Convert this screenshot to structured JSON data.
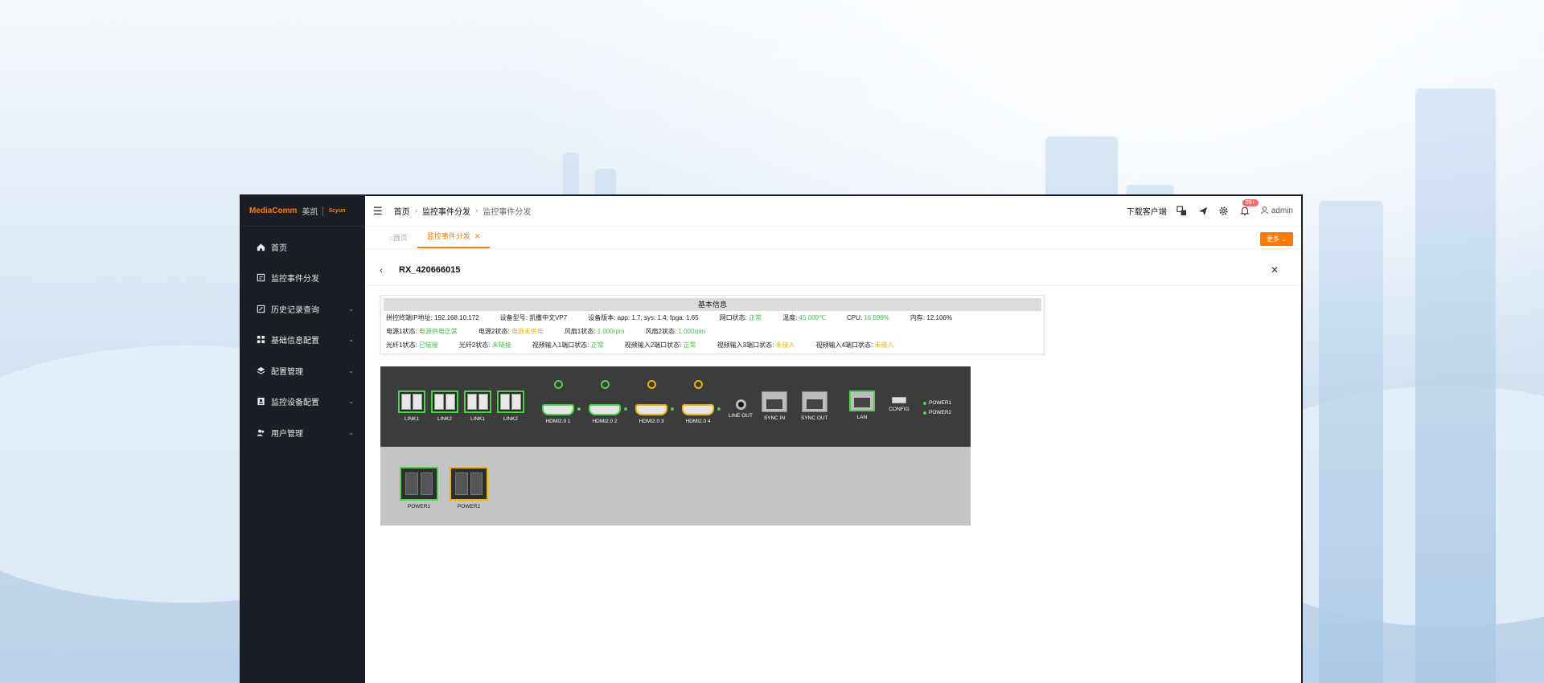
{
  "sidebar": {
    "logo_main": "MediaComm",
    "logo_cn": "美凯",
    "logo_sub": "Scyun",
    "items": [
      {
        "label": "首页",
        "icon": "home-icon"
      },
      {
        "label": "监控事件分发",
        "icon": "monitor-event-icon"
      },
      {
        "label": "历史记录查询",
        "icon": "history-icon"
      },
      {
        "label": "基础信息配置",
        "icon": "grid-config-icon"
      },
      {
        "label": "配置管理",
        "icon": "layers-icon"
      },
      {
        "label": "监控设备配置",
        "icon": "device-icon"
      },
      {
        "label": "用户管理",
        "icon": "users-icon"
      }
    ]
  },
  "topbar": {
    "breadcrumb": [
      "首页",
      "监控事件分发",
      "监控事件分发"
    ],
    "download": "下载客户端",
    "badge": "99+",
    "user": "admin"
  },
  "tabs": {
    "items": [
      {
        "label": "首页"
      },
      {
        "label": "监控事件分发",
        "active": true
      }
    ],
    "more": "更多"
  },
  "detail": {
    "title": "RX_420666015"
  },
  "info": {
    "title": "基本信息",
    "row1": [
      {
        "k": "拼控终端IP地址: ",
        "v": "192.168.10.172",
        "c": ""
      },
      {
        "k": "设备型号: ",
        "v": "凯撒中文VP7",
        "c": ""
      },
      {
        "k": "设备版本: ",
        "v": "app: 1.7; sys: 1.4; fpga: 1.65",
        "c": ""
      },
      {
        "k": "网口状态: ",
        "v": "正常",
        "c": "green"
      },
      {
        "k": "温度: ",
        "v": "45.000℃",
        "c": "green"
      },
      {
        "k": "CPU: ",
        "v": "16.598%",
        "c": "green"
      },
      {
        "k": "内存: ",
        "v": "12.106%",
        "c": ""
      }
    ],
    "row2": [
      {
        "k": "电源1状态: ",
        "v": "电源供电正常",
        "c": "green"
      },
      {
        "k": "电源2状态: ",
        "v": "电源未供电",
        "c": "yellow"
      },
      {
        "k": "风扇1状态: ",
        "v": "1.000rpm",
        "c": "green"
      },
      {
        "k": "风扇2状态: ",
        "v": "1.000rpm",
        "c": "green"
      }
    ],
    "row3": [
      {
        "k": "光纤1状态: ",
        "v": "已链接",
        "c": "green"
      },
      {
        "k": "光纤2状态: ",
        "v": "未链接",
        "c": "green"
      },
      {
        "k": "视频输入1端口状态: ",
        "v": "正常",
        "c": "green"
      },
      {
        "k": "视频输入2端口状态: ",
        "v": "正常",
        "c": "green"
      },
      {
        "k": "视频输入3端口状态: ",
        "v": "未接入",
        "c": "yellow"
      },
      {
        "k": "视频输入4端口状态: ",
        "v": "未接入",
        "c": "yellow"
      }
    ]
  },
  "panel": {
    "sfp_labels": [
      "LINK1",
      "LINK2",
      "LINK1",
      "LINK2"
    ],
    "hdmi_labels": [
      "HDMI2.0 1",
      "HDMI2.0 2",
      "HDMI2.0 3",
      "HDMI2.0 4"
    ],
    "line_out": "LINE OUT",
    "sync_in": "SYNC IN",
    "sync_out": "SYNC OUT",
    "lan": "LAN",
    "config": "CONFIG",
    "power1_led": "POWER1",
    "power2_led": "POWER2",
    "psu1": "POWER1",
    "psu2": "POWER2"
  }
}
